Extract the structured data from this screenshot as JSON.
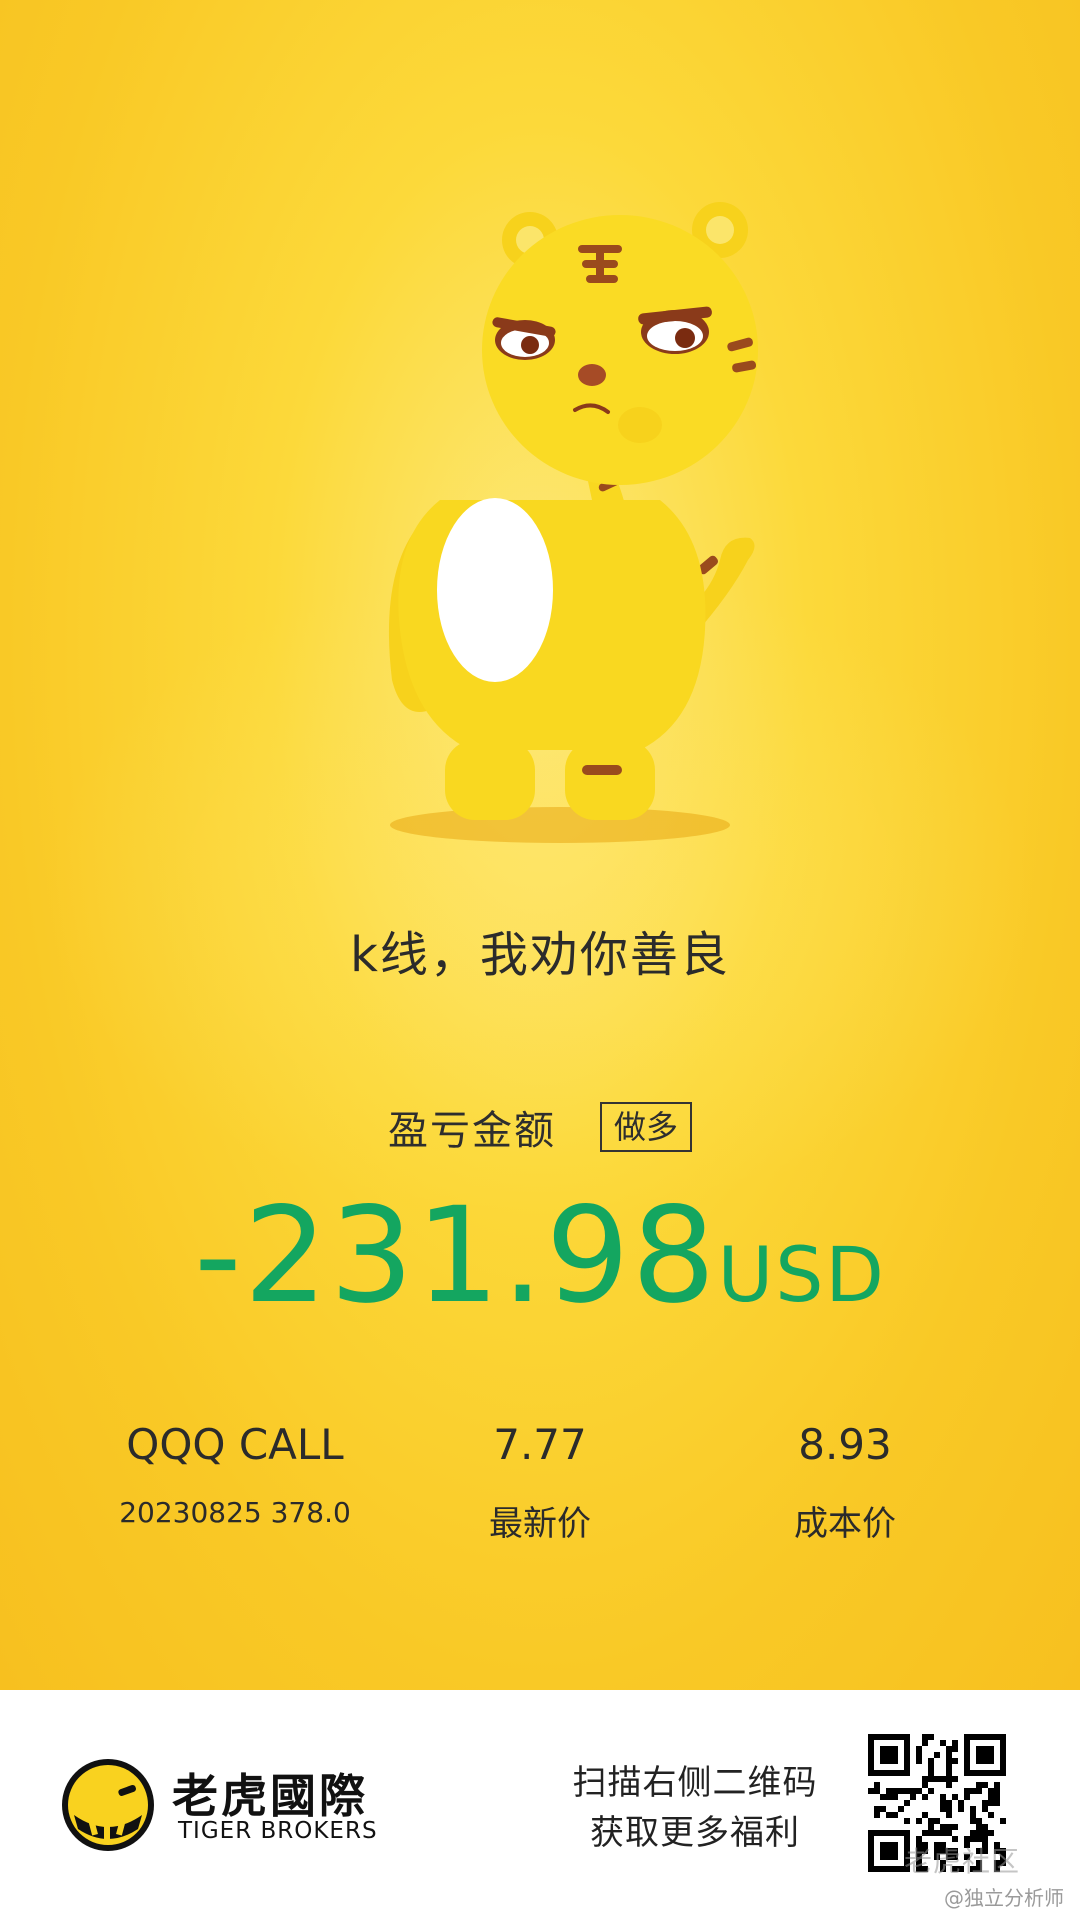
{
  "poster": {
    "slogan": "k线，我劝你善良",
    "pl_label": "盈亏金额",
    "direction_badge": "做多",
    "amount": "-231.98",
    "currency": "USD",
    "symbol": "QQQ CALL",
    "expiry_strike": "20230825 378.0",
    "latest_price": "7.77",
    "latest_price_label": "最新价",
    "cost_price": "8.93",
    "cost_price_label": "成本价",
    "mascot": "tiger-mascot-icon"
  },
  "footer": {
    "brand_cn": "老虎國際",
    "brand_en": "TIGER BROKERS",
    "scan_line1": "扫描右侧二维码",
    "scan_line2": "获取更多福利",
    "qr": "qr-code-icon",
    "watermark_community": "老虎社区",
    "watermark_handle": "@独立分析师"
  },
  "colors": {
    "background": "#fcd93a",
    "loss_green": "#14a660",
    "text_dark": "#2b2b2b",
    "footer_bg": "#ffffff"
  }
}
